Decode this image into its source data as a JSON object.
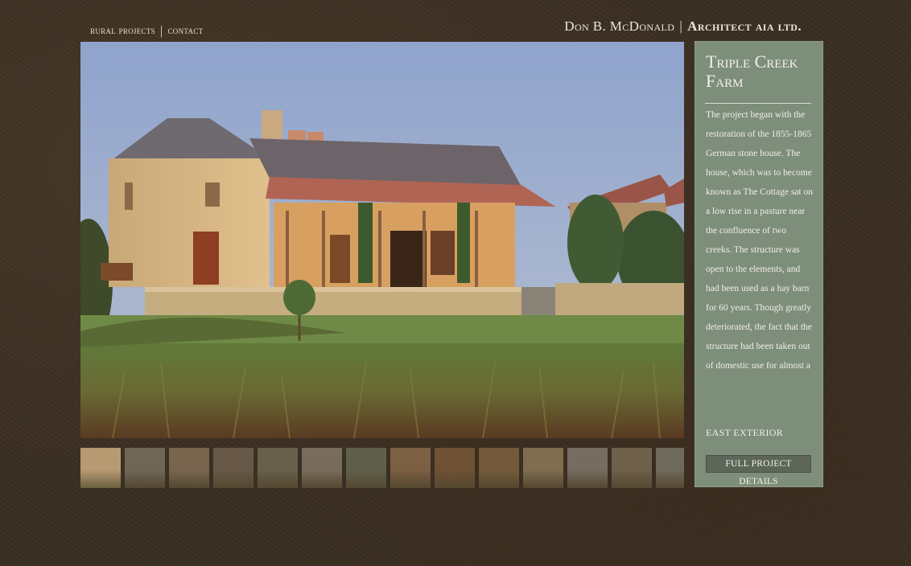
{
  "nav": {
    "items": [
      {
        "label": "rural projects"
      },
      {
        "label": "contact"
      }
    ],
    "separator": "|"
  },
  "brand": {
    "name": "Don B. McDonald",
    "separator": "|",
    "firm": "Architect aia ltd."
  },
  "project": {
    "title": "Triple Creek Farm",
    "description": "The project began with the restoration of the 1855-1865 German stone house. The house, which was to become known as The Cottage sat on a low rise in a pasture near the confluence of two creeks. The structure was open to the elements, and had been used as a hay barn for 60 years. Though greatly deteriorated, the fact that the structure had been taken out of domestic use for almost a",
    "caption": "EAST EXTERIOR",
    "details_button": "FULL PROJECT DETAILS"
  },
  "thumbnails": [
    {
      "name": "thumb-east-exterior",
      "color": "#b89a72",
      "selected": true
    },
    {
      "name": "thumb-2",
      "color": "#9a9688"
    },
    {
      "name": "thumb-3",
      "color": "#a89476"
    },
    {
      "name": "thumb-4",
      "color": "#8c7d6a"
    },
    {
      "name": "thumb-5",
      "color": "#8a8a70"
    },
    {
      "name": "thumb-6",
      "color": "#aaa290"
    },
    {
      "name": "thumb-7",
      "color": "#7d8a72"
    },
    {
      "name": "thumb-8",
      "color": "#b08a60"
    },
    {
      "name": "thumb-9",
      "color": "#9a7044"
    },
    {
      "name": "thumb-10",
      "color": "#a08050"
    },
    {
      "name": "thumb-11",
      "color": "#b8a278"
    },
    {
      "name": "thumb-12",
      "color": "#a4a298"
    },
    {
      "name": "thumb-13",
      "color": "#9a8a6e"
    },
    {
      "name": "thumb-14",
      "color": "#9a9a90"
    }
  ],
  "colors": {
    "background": "#3a2e22",
    "panel": "#7d8e7a",
    "button": "#5c6659"
  }
}
